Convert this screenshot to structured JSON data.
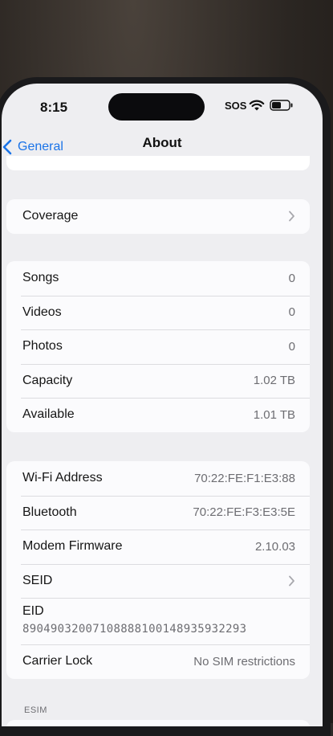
{
  "status_bar": {
    "time": "8:15",
    "carrier": "SOS",
    "icons": [
      "wifi-icon",
      "battery-icon"
    ]
  },
  "nav": {
    "back_label": "General",
    "title": "About"
  },
  "colors": {
    "accent": "#1a73e8",
    "screen_background": "#eeeef1",
    "cell_background": "#fbfbfd"
  },
  "groups": [
    {
      "rows": [
        {
          "label": "Coverage",
          "chevron": true
        }
      ]
    },
    {
      "rows": [
        {
          "label": "Songs",
          "value": "0"
        },
        {
          "label": "Videos",
          "value": "0"
        },
        {
          "label": "Photos",
          "value": "0"
        },
        {
          "label": "Capacity",
          "value": "1.02 TB"
        },
        {
          "label": "Available",
          "value": "1.01 TB"
        }
      ]
    },
    {
      "rows": [
        {
          "label": "Wi-Fi Address",
          "value": "70:22:FE:F1:E3:88"
        },
        {
          "label": "Bluetooth",
          "value": "70:22:FE:F3:E3:5E"
        },
        {
          "label": "Modem Firmware",
          "value": "2.10.03"
        },
        {
          "label": "SEID",
          "chevron": true
        },
        {
          "label": "EID",
          "value": "89049032007108888100148935932293"
        },
        {
          "label": "Carrier Lock",
          "value": "No SIM restrictions"
        }
      ]
    }
  ],
  "section_footer": "ESIM"
}
